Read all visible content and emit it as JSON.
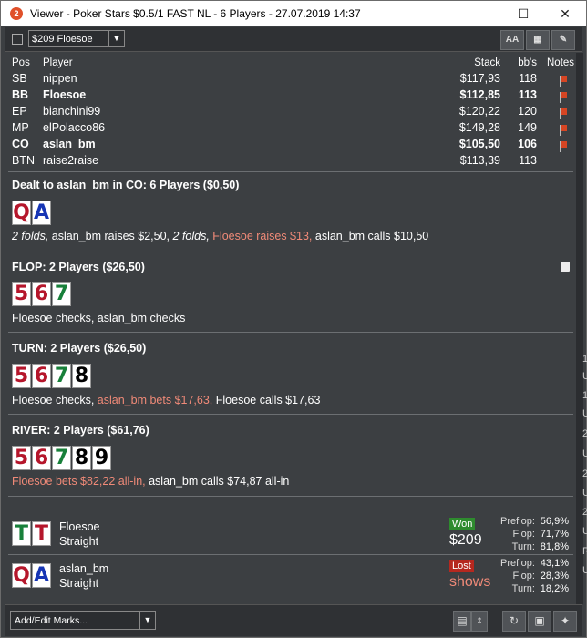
{
  "title": "Viewer - Poker Stars $0.5/1 FAST NL - 6 Players - 27.07.2019 14:37",
  "app_icon_glyph": "2",
  "window_buttons": {
    "minimize": "—",
    "maximize": "☐",
    "close": "✕"
  },
  "toolbar": {
    "player_select": "$209 Floesoe",
    "font_button": "AA",
    "grid_button": "▦",
    "edit_button": "✎"
  },
  "table_headers": {
    "pos": "Pos",
    "player": "Player",
    "stack": "Stack",
    "bbs": "bb's",
    "notes": "Notes"
  },
  "players": [
    {
      "pos": "SB",
      "player": "nippen",
      "stack": "$117,93",
      "bbs": "118",
      "bold": false
    },
    {
      "pos": "BB",
      "player": "Floesoe",
      "stack": "$112,85",
      "bbs": "113",
      "bold": true
    },
    {
      "pos": "EP",
      "player": "bianchini99",
      "stack": "$120,22",
      "bbs": "120",
      "bold": false
    },
    {
      "pos": "MP",
      "player": "elPolacco86",
      "stack": "$149,28",
      "bbs": "149",
      "bold": false
    },
    {
      "pos": "CO",
      "player": "aslan_bm",
      "stack": "$105,50",
      "bbs": "106",
      "bold": true
    },
    {
      "pos": "BTN",
      "player": "raise2raise",
      "stack": "$113,39",
      "bbs": "113",
      "bold": false
    }
  ],
  "preflop": {
    "title": "Dealt to aslan_bm in CO: 6 Players ($0,50)",
    "cards": [
      "Q",
      "A"
    ],
    "a1": "2 folds,",
    "a2": " aslan_bm raises $2,50, ",
    "a3": "2 folds,",
    "a4": " Floesoe raises $13,",
    "a5": " aslan_bm calls $10,50"
  },
  "flop": {
    "title": "FLOP: 2 Players ($26,50)",
    "cards": [
      "5",
      "6",
      "7"
    ],
    "action": "Floesoe checks, aslan_bm checks"
  },
  "turn": {
    "title": "TURN: 2 Players ($26,50)",
    "cards": [
      "5",
      "6",
      "7",
      "8"
    ],
    "a1": "Floesoe checks,",
    "a2": " aslan_bm bets $17,63,",
    "a3": " Floesoe calls $17,63"
  },
  "river": {
    "title": "RIVER: 2 Players ($61,76)",
    "cards": [
      "5",
      "6",
      "7",
      "8",
      "9"
    ],
    "a1": "Floesoe bets $82,22 all-in,",
    "a2": " aslan_bm calls $74,87 all-in"
  },
  "results": [
    {
      "cards": [
        "T",
        "T"
      ],
      "name": "Floesoe",
      "hand": "Straight",
      "badge": "Won",
      "amount": "$209",
      "pre_label": "Preflop:",
      "pre": "56,9%",
      "flop_label": "Flop:",
      "flop": "71,7%",
      "turn_label": "Turn:",
      "turn": "81,8%"
    },
    {
      "cards": [
        "Q",
        "A"
      ],
      "name": "aslan_bm",
      "hand": "Straight",
      "badge": "Lost",
      "amount": "shows",
      "pre_label": "Preflop:",
      "pre": "43,1%",
      "flop_label": "Flop:",
      "flop": "28,3%",
      "turn_label": "Turn:",
      "turn": "18,2%"
    }
  ],
  "bottom": {
    "marks_placeholder": "Add/Edit Marks..."
  },
  "background_strip": [
    "1",
    "U",
    "1",
    "U",
    "2",
    "U",
    "2",
    "U",
    "2",
    "U",
    "R",
    "U"
  ]
}
